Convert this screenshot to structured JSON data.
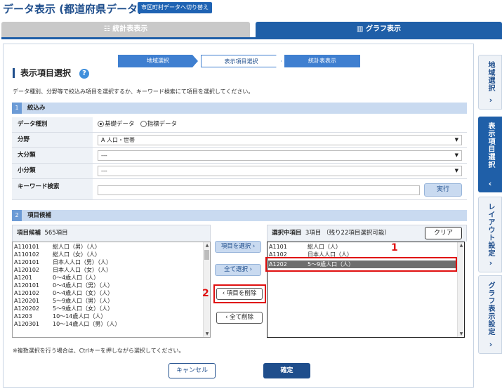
{
  "header": {
    "title": "データ表示 (都道府県データ)",
    "switch_label": "市区町村データへ切り替え"
  },
  "tabs": [
    {
      "label": "☷ 統計表表示",
      "active": false
    },
    {
      "label": "▥ グラフ表示",
      "active": true
    }
  ],
  "steps": [
    "地域選択",
    "表示項目選択",
    "統計表表示"
  ],
  "section_title": "表示項目選択",
  "help_icon": "?",
  "instruction": "データ種別、分野等で絞込み項目を選択するか、キーワード検索にて項目を選択してください。",
  "filter": {
    "num": "1",
    "label": "絞込み",
    "data_type_label": "データ種別",
    "data_type_options": [
      "基礎データ",
      "指標データ"
    ],
    "field_label": "分野",
    "field_value": "A 人口・世帯",
    "major_label": "大分類",
    "major_value": "---",
    "minor_label": "小分類",
    "minor_value": "---",
    "keyword_label": "キーワード検索",
    "run_label": "実行"
  },
  "candidates": {
    "num": "2",
    "label": "項目候補",
    "header": "項目候補",
    "count": "565項目",
    "items": [
      {
        "code": "A110101",
        "name": "総人口（男）（人）"
      },
      {
        "code": "A110102",
        "name": "総人口（女）（人）"
      },
      {
        "code": "A120101",
        "name": "日本人人口（男）（人）"
      },
      {
        "code": "A120102",
        "name": "日本人人口（女）（人）"
      },
      {
        "code": "A1201",
        "name": "0～4歳人口（人）"
      },
      {
        "code": "A120101",
        "name": "0～4歳人口（男）（人）"
      },
      {
        "code": "A120102",
        "name": "0～4歳人口（女）（人）"
      },
      {
        "code": "A120201",
        "name": "5～9歳人口（男）（人）"
      },
      {
        "code": "A120202",
        "name": "5～9歳人口（女）（人）"
      },
      {
        "code": "A1203",
        "name": "10～14歳人口（人）"
      },
      {
        "code": "A120301",
        "name": "10～14歳人口（男）（人）"
      }
    ]
  },
  "buttons": {
    "select": "項目を選択 ›",
    "select_all": "全て選択 ›",
    "remove": "‹ 項目を削除",
    "remove_all": "‹ 全て削除",
    "clear": "クリア",
    "cancel": "キャンセル",
    "confirm": "確定"
  },
  "selected": {
    "header": "選択中項目",
    "count": "3項目 （残り22項目選択可能）",
    "items": [
      {
        "code": "A1101",
        "name": "総人口（人）"
      },
      {
        "code": "A1102",
        "name": "日本人人口（人）"
      },
      {
        "code": "A1202",
        "name": "5～9歳人口（人）"
      }
    ],
    "selected_index": 2
  },
  "markers": [
    "1",
    "2"
  ],
  "note": "※複数選択を行う場合は、Ctrlキーを押しながら選択してください。",
  "side_tabs": [
    {
      "label": "地域選択",
      "chevron": "›"
    },
    {
      "label": "表示項目選択",
      "chevron": "‹"
    },
    {
      "label": "レイアウト設定",
      "chevron": "›"
    },
    {
      "label": "グラフ表示設定",
      "chevron": "›"
    }
  ],
  "colors": {
    "primary": "#1f5fa8",
    "highlight": "#e01010",
    "light": "#c9daf0"
  }
}
